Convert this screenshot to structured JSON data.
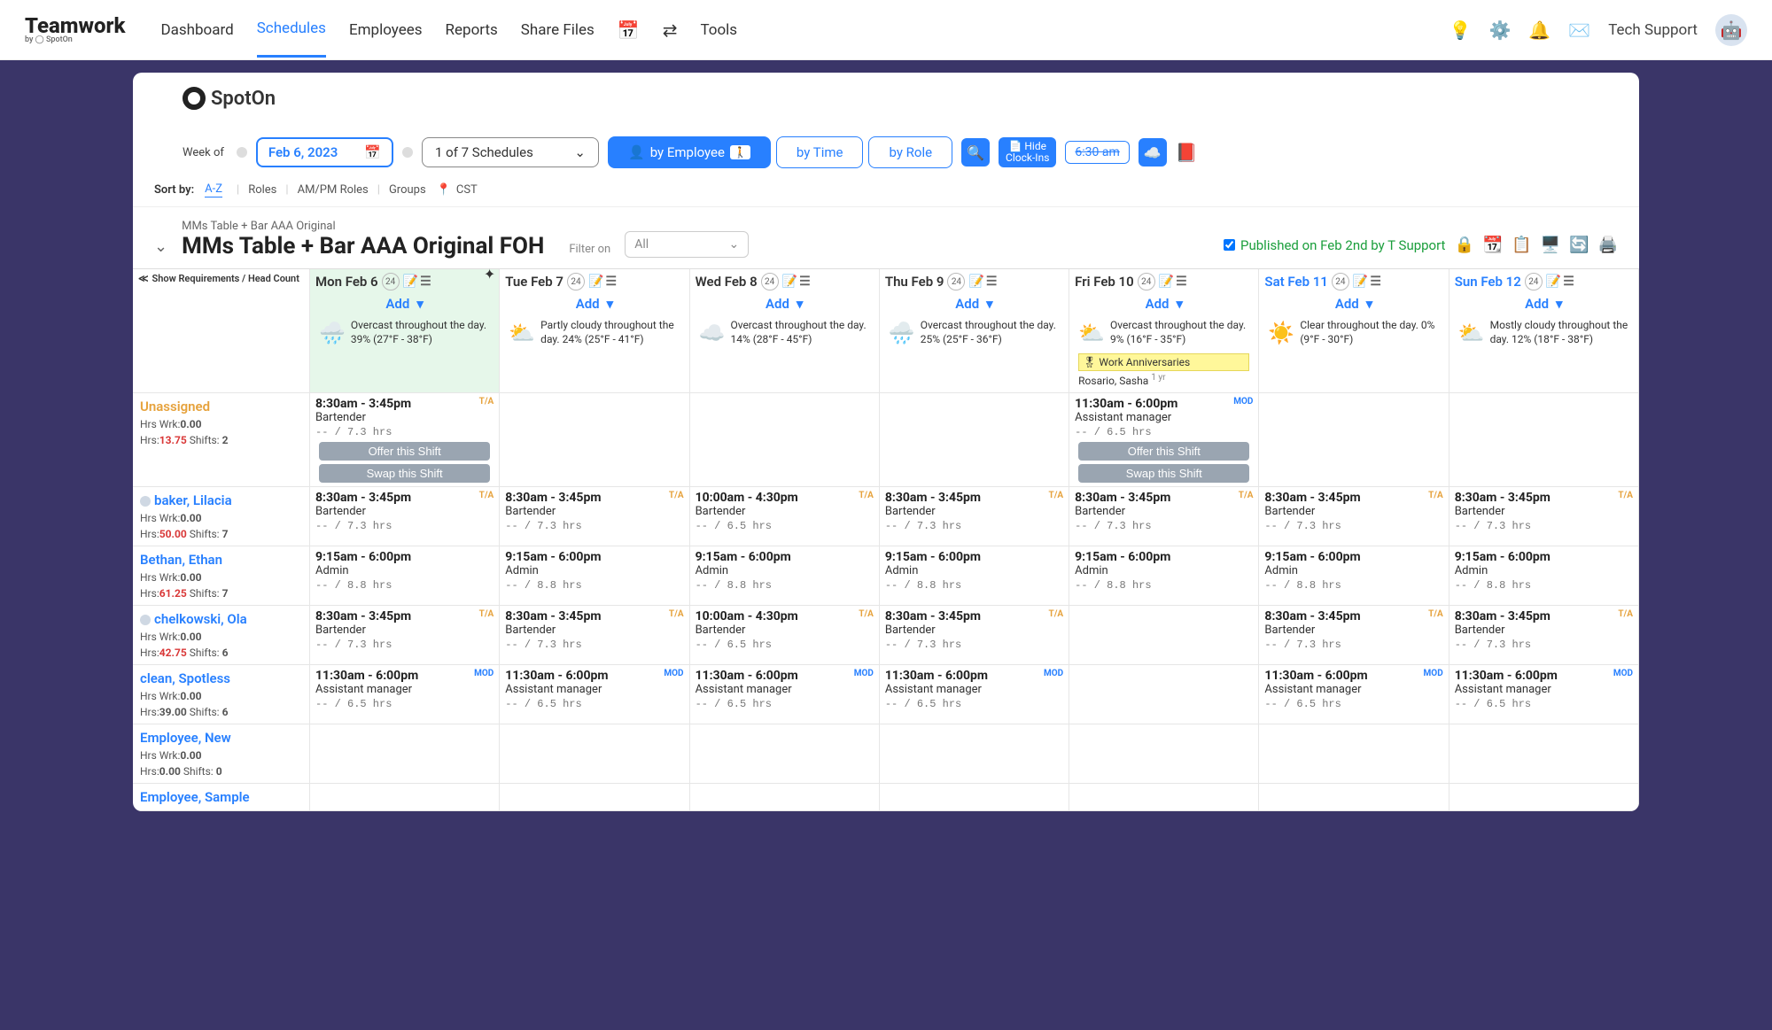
{
  "topnav": {
    "logo": "Teamwork",
    "logo_sub": "by ◯ SpotOn",
    "items": [
      "Dashboard",
      "Schedules",
      "Employees",
      "Reports",
      "Share Files"
    ],
    "active": "Schedules",
    "tools": "Tools",
    "tech_support": "Tech Support"
  },
  "brand": "SpotOn",
  "controls": {
    "week_of": "Week of",
    "date": "Feb 6, 2023",
    "schedule_select": "1 of 7 Schedules",
    "by_employee": "by Employee",
    "by_time": "by Time",
    "by_role": "by Role",
    "hide_clockins_l1": "Hide",
    "hide_clockins_l2": "Clock-Ins",
    "strike_time": "6:30 am"
  },
  "sortbar": {
    "label": "Sort by:",
    "az": "A-Z",
    "roles": "Roles",
    "ampm": "AM/PM Roles",
    "groups": "Groups",
    "tz": "CST"
  },
  "schedule": {
    "sub": "MMs Table + Bar AAA Original",
    "title": "MMs Table + Bar AAA Original FOH",
    "filter_label": "Filter on",
    "filter_value": "All",
    "published": "Published on Feb 2nd by T Support"
  },
  "req_label": "Show Requirements / Head Count",
  "days": [
    {
      "label": "Mon Feb 6",
      "badge": "24",
      "today": true,
      "add": "Add",
      "weather": {
        "icon": "🌧️",
        "text": "Overcast throughout the day. 39% (27°F - 38°F)"
      },
      "star": true
    },
    {
      "label": "Tue Feb 7",
      "badge": "24",
      "add": "Add",
      "weather": {
        "icon": "⛅",
        "text": "Partly cloudy throughout the day. 24% (25°F - 41°F)"
      }
    },
    {
      "label": "Wed Feb 8",
      "badge": "24",
      "add": "Add",
      "weather": {
        "icon": "☁️",
        "text": "Overcast throughout the day. 14% (28°F - 45°F)"
      }
    },
    {
      "label": "Thu Feb 9",
      "badge": "24",
      "add": "Add",
      "weather": {
        "icon": "🌧️",
        "text": "Overcast throughout the day. 25% (25°F - 36°F)"
      }
    },
    {
      "label": "Fri Feb 10",
      "badge": "24",
      "add": "Add",
      "weather": {
        "icon": "⛅",
        "text": "Overcast throughout the day. 9% (16°F - 35°F)"
      },
      "anniv": {
        "title": "Work Anniversaries",
        "name": "Rosario, Sasha",
        "yr": "1 yr"
      }
    },
    {
      "label": "Sat Feb 11",
      "badge": "24",
      "class": "sat",
      "add": "Add",
      "weather": {
        "icon": "☀️",
        "text": "Clear throughout the day. 0% (9°F - 30°F)"
      }
    },
    {
      "label": "Sun Feb 12",
      "badge": "24",
      "class": "sun",
      "add": "Add",
      "weather": {
        "icon": "⛅",
        "text": "Mostly cloudy throughout the day. 12% (18°F - 38°F)"
      }
    }
  ],
  "offer_btn": "Offer this Shift",
  "swap_btn": "Swap this Shift",
  "rows": [
    {
      "name": "Unassigned",
      "name_class": "unassigned",
      "stats": [
        {
          "l": "Hrs Wrk:",
          "v": "0.00"
        },
        {
          "l": "Hrs:",
          "v": "13.75",
          "red": true,
          "l2": "Shifts:",
          "v2": "2"
        }
      ],
      "cells": [
        {
          "time": "8:30am - 3:45pm",
          "role": "Bartender",
          "hrs": "-- / 7.3 hrs",
          "ta": "T/A",
          "offer": true
        },
        null,
        null,
        null,
        {
          "time": "11:30am - 6:00pm",
          "role": "Assistant manager",
          "hrs": "-- / 6.5 hrs",
          "mod": "MOD",
          "offer": true
        },
        null,
        null
      ]
    },
    {
      "name": "baker, Lilacia",
      "name_class": "link",
      "dot": true,
      "stats": [
        {
          "l": "Hrs Wrk:",
          "v": "0.00"
        },
        {
          "l": "Hrs:",
          "v": "50.00",
          "red": true,
          "l2": "Shifts:",
          "v2": "7"
        }
      ],
      "cells": [
        {
          "time": "8:30am - 3:45pm",
          "role": "Bartender",
          "hrs": "-- / 7.3 hrs",
          "ta": "T/A"
        },
        {
          "time": "8:30am - 3:45pm",
          "role": "Bartender",
          "hrs": "-- / 7.3 hrs",
          "ta": "T/A"
        },
        {
          "time": "10:00am - 4:30pm",
          "role": "Bartender",
          "hrs": "-- / 6.5 hrs",
          "ta": "T/A"
        },
        {
          "time": "8:30am - 3:45pm",
          "role": "Bartender",
          "hrs": "-- / 7.3 hrs",
          "ta": "T/A"
        },
        {
          "time": "8:30am - 3:45pm",
          "role": "Bartender",
          "hrs": "-- / 7.3 hrs",
          "ta": "T/A"
        },
        {
          "time": "8:30am - 3:45pm",
          "role": "Bartender",
          "hrs": "-- / 7.3 hrs",
          "ta": "T/A"
        },
        {
          "time": "8:30am - 3:45pm",
          "role": "Bartender",
          "hrs": "-- / 7.3 hrs",
          "ta": "T/A"
        }
      ]
    },
    {
      "name": "Bethan, Ethan",
      "name_class": "link",
      "stats": [
        {
          "l": "Hrs Wrk:",
          "v": "0.00"
        },
        {
          "l": "Hrs:",
          "v": "61.25",
          "red": true,
          "l2": "Shifts:",
          "v2": "7"
        }
      ],
      "cells": [
        {
          "time": "9:15am - 6:00pm",
          "role": "Admin",
          "hrs": "-- / 8.8 hrs"
        },
        {
          "time": "9:15am - 6:00pm",
          "role": "Admin",
          "hrs": "-- / 8.8 hrs"
        },
        {
          "time": "9:15am - 6:00pm",
          "role": "Admin",
          "hrs": "-- / 8.8 hrs"
        },
        {
          "time": "9:15am - 6:00pm",
          "role": "Admin",
          "hrs": "-- / 8.8 hrs"
        },
        {
          "time": "9:15am - 6:00pm",
          "role": "Admin",
          "hrs": "-- / 8.8 hrs"
        },
        {
          "time": "9:15am - 6:00pm",
          "role": "Admin",
          "hrs": "-- / 8.8 hrs"
        },
        {
          "time": "9:15am - 6:00pm",
          "role": "Admin",
          "hrs": "-- / 8.8 hrs"
        }
      ]
    },
    {
      "name": "chelkowski, Ola",
      "name_class": "link",
      "dot": true,
      "stats": [
        {
          "l": "Hrs Wrk:",
          "v": "0.00"
        },
        {
          "l": "Hrs:",
          "v": "42.75",
          "red": true,
          "l2": "Shifts:",
          "v2": "6"
        }
      ],
      "cells": [
        {
          "time": "8:30am - 3:45pm",
          "role": "Bartender",
          "hrs": "-- / 7.3 hrs",
          "ta": "T/A"
        },
        {
          "time": "8:30am - 3:45pm",
          "role": "Bartender",
          "hrs": "-- / 7.3 hrs",
          "ta": "T/A"
        },
        {
          "time": "10:00am - 4:30pm",
          "role": "Bartender",
          "hrs": "-- / 6.5 hrs",
          "ta": "T/A"
        },
        {
          "time": "8:30am - 3:45pm",
          "role": "Bartender",
          "hrs": "-- / 7.3 hrs",
          "ta": "T/A"
        },
        null,
        {
          "time": "8:30am - 3:45pm",
          "role": "Bartender",
          "hrs": "-- / 7.3 hrs",
          "ta": "T/A"
        },
        {
          "time": "8:30am - 3:45pm",
          "role": "Bartender",
          "hrs": "-- / 7.3 hrs",
          "ta": "T/A"
        }
      ]
    },
    {
      "name": "clean, Spotless",
      "name_class": "link",
      "stats": [
        {
          "l": "Hrs Wrk:",
          "v": "0.00"
        },
        {
          "l": "Hrs:",
          "v": "39.00",
          "l2": "Shifts:",
          "v2": "6"
        }
      ],
      "cells": [
        {
          "time": "11:30am - 6:00pm",
          "role": "Assistant manager",
          "hrs": "-- / 6.5 hrs",
          "mod": "MOD"
        },
        {
          "time": "11:30am - 6:00pm",
          "role": "Assistant manager",
          "hrs": "-- / 6.5 hrs",
          "mod": "MOD"
        },
        {
          "time": "11:30am - 6:00pm",
          "role": "Assistant manager",
          "hrs": "-- / 6.5 hrs",
          "mod": "MOD"
        },
        {
          "time": "11:30am - 6:00pm",
          "role": "Assistant manager",
          "hrs": "-- / 6.5 hrs",
          "mod": "MOD"
        },
        null,
        {
          "time": "11:30am - 6:00pm",
          "role": "Assistant manager",
          "hrs": "-- / 6.5 hrs",
          "mod": "MOD"
        },
        {
          "time": "11:30am - 6:00pm",
          "role": "Assistant manager",
          "hrs": "-- / 6.5 hrs",
          "mod": "MOD"
        }
      ]
    },
    {
      "name": "Employee, New",
      "name_class": "link",
      "stats": [
        {
          "l": "Hrs Wrk:",
          "v": "0.00"
        },
        {
          "l": "Hrs:",
          "v": "0.00",
          "l2": "Shifts:",
          "v2": "0"
        }
      ],
      "cells": [
        null,
        null,
        null,
        null,
        null,
        null,
        null
      ]
    },
    {
      "name": "Employee, Sample",
      "name_class": "link",
      "stats": [],
      "cells": [
        null,
        null,
        null,
        null,
        null,
        null,
        null
      ],
      "partial": true
    }
  ]
}
